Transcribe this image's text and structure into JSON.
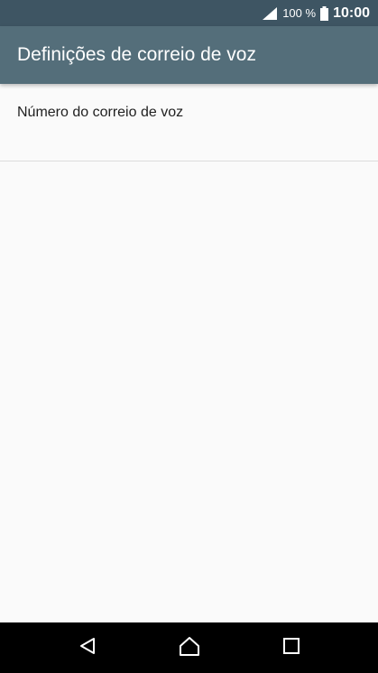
{
  "status_bar": {
    "battery_percent": "100 %",
    "time": "10:00",
    "icons": [
      "signal-icon",
      "battery-icon"
    ]
  },
  "app_bar": {
    "title": "Definições de correio de voz"
  },
  "settings": {
    "items": [
      {
        "label": "Número do correio de voz"
      }
    ]
  },
  "nav_bar": {
    "icons": [
      "back-icon",
      "home-icon",
      "recents-icon"
    ]
  },
  "colors": {
    "status_bar": "#3e5563",
    "app_bar": "#546e7a",
    "background": "#fafafa",
    "nav_bar": "#000000"
  }
}
